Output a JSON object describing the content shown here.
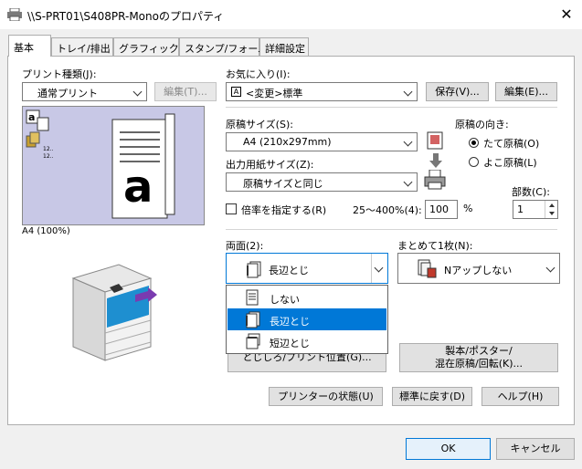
{
  "window": {
    "title": "\\\\S-PRT01\\S408PR-Monoのプロパティ",
    "close_label": "✕"
  },
  "tabs": [
    {
      "label": "基本",
      "active": true
    },
    {
      "label": "トレイ/排出",
      "active": false
    },
    {
      "label": "グラフィックス",
      "active": false
    },
    {
      "label": "スタンプ/フォーム",
      "active": false
    },
    {
      "label": "詳細設定",
      "active": false
    }
  ],
  "print_type": {
    "label": "プリント種類(J):",
    "value": "通常プリント",
    "edit_button": "編集(T)..."
  },
  "favorites": {
    "label": "お気に入り(I):",
    "value": "<変更>標準",
    "save_button": "保存(V)...",
    "edit_button": "編集(E)..."
  },
  "preview": {
    "caption": "A4 (100%)",
    "thumb_text1": "12..",
    "thumb_text2": "12.."
  },
  "paper_size": {
    "label": "原稿サイズ(S):",
    "value": "A4 (210x297mm)"
  },
  "output_size": {
    "label": "出力用紙サイズ(Z):",
    "value": "原稿サイズと同じ"
  },
  "orientation": {
    "label": "原稿の向き:",
    "portrait": "たて原稿(O)",
    "landscape": "よこ原稿(L)",
    "selected": "portrait"
  },
  "copies": {
    "label": "部数(C):",
    "value": "1"
  },
  "scale": {
    "checkbox_label": "倍率を指定する(R)",
    "range_label": "25〜400%(4):",
    "value": "100",
    "unit": "%"
  },
  "duplex": {
    "label": "両面(2):",
    "value": "長辺とじ",
    "options": [
      {
        "label": "しない",
        "selected": false
      },
      {
        "label": "長辺とじ",
        "selected": true
      },
      {
        "label": "短辺とじ",
        "selected": false
      }
    ],
    "hidden_button": "とじしろ/プリント位置(G)..."
  },
  "nup": {
    "label": "まとめて1枚(N):",
    "value": "Nアップしない"
  },
  "booklet_button": {
    "line1": "製本/ポスター/",
    "line2": "混在原稿/回転(K)..."
  },
  "buttons": {
    "status": "プリンターの状態(U)",
    "default": "標準に戻す(D)",
    "help": "ヘルプ(H)",
    "ok": "OK",
    "cancel": "キャンセル"
  }
}
